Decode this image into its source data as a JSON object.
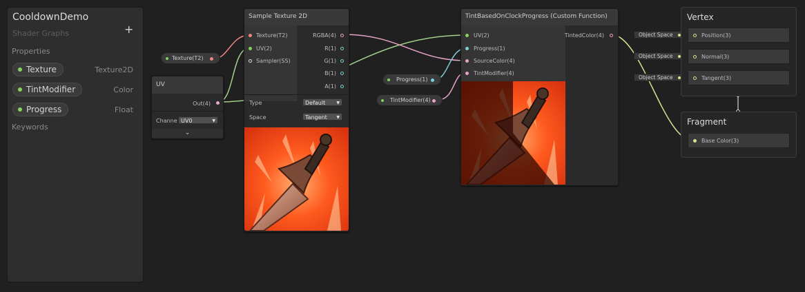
{
  "blackboard": {
    "title": "CooldownDemo",
    "subtitle": "Shader Graphs",
    "add_label": "+",
    "properties_heading": "Properties",
    "keywords_heading": "Keywords",
    "properties": [
      {
        "name": "Texture",
        "type": "Texture2D"
      },
      {
        "name": "TintModifier",
        "type": "Color"
      },
      {
        "name": "Progress",
        "type": "Float"
      }
    ]
  },
  "texture_prop_node": {
    "label": "Texture(T2)"
  },
  "progress_prop_node": {
    "label": "Progress(1)"
  },
  "tint_prop_node": {
    "label": "TintModifier(4)"
  },
  "uv_node": {
    "title": "UV",
    "out_label": "Out(4)",
    "channel_label": "Channe",
    "channel_value": "UV0",
    "collapse_icon": "chevron-down-icon"
  },
  "sample_node": {
    "title": "Sample Texture 2D",
    "inputs": [
      "Texture(T2)",
      "UV(2)",
      "Sampler(SS)"
    ],
    "outputs": [
      "RGBA(4)",
      "R(1)",
      "G(1)",
      "B(1)",
      "A(1)"
    ],
    "type_label": "Type",
    "type_value": "Default",
    "space_label": "Space",
    "space_value": "Tangent"
  },
  "tint_node": {
    "title": "TintBasedOnClockProgress (Custom Function)",
    "inputs": [
      "UV(2)",
      "Progress(1)",
      "SourceColor(4)",
      "TintModifier(4)"
    ],
    "output": "TintedColor(4)"
  },
  "vertex": {
    "title": "Vertex",
    "slots": [
      "Position(3)",
      "Normal(3)",
      "Tangent(3)"
    ],
    "space_chips": [
      "Object Space",
      "Object Space",
      "Object Space"
    ]
  },
  "fragment": {
    "title": "Fragment",
    "slots": [
      "Base Color(3)"
    ]
  },
  "colors": {
    "background": "#202020",
    "vector4": "#e7a3c8",
    "vector2": "#85d35e",
    "float": "#7bd1d9",
    "texture": "#ef8585",
    "vector3": "#d7e38f"
  }
}
